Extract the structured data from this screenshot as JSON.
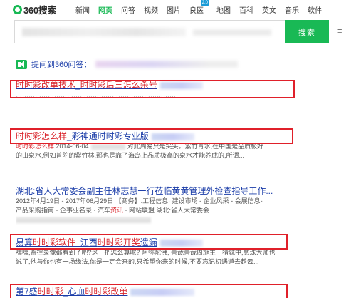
{
  "logo": {
    "text": "360搜索"
  },
  "nav": [
    {
      "label": "新闻",
      "active": false
    },
    {
      "label": "网页",
      "active": true
    },
    {
      "label": "问答",
      "active": false
    },
    {
      "label": "视频",
      "active": false
    },
    {
      "label": "图片",
      "active": false
    },
    {
      "label": "良医",
      "active": false,
      "badge": "2.0"
    },
    {
      "label": "地图",
      "active": false
    },
    {
      "label": "百科",
      "active": false
    },
    {
      "label": "英文",
      "active": false
    },
    {
      "label": "音乐",
      "active": false
    },
    {
      "label": "软件",
      "active": false
    }
  ],
  "search": {
    "button_label": "搜索"
  },
  "notice": {
    "link_text": "提问到360问答："
  },
  "results": [
    {
      "title_red": "时时彩改单技术",
      "title_sep": "_",
      "title_red2": "时时彩后三怎么杀号",
      "line1": "…………………………………………………………………",
      "line2": "…………………………………………………………………"
    },
    {
      "title_red": "时时彩怎么样",
      "title_sep": "_",
      "title_rest": "彩神通时时彩专业版",
      "body_red": "时时彩怎么样",
      "body_date": " 2014-06-04",
      "body_text": "对此周易只是笑笑。紫竹青水,在中国是品质极好",
      "line2": "的山泉水,例如普陀的紫竹林,那也是靠了海岛上品质极高的泉水才能养成的,所谓..."
    },
    {
      "title": "湖北:省人大常委会副主任林志慧一行莅临黄黄管理外检查指导工作...",
      "line1": "2012年4月19日 - 2017年06月29日 【商务】:工程信息· 建设市场 - 企业风采 - 会展信息-",
      "line2_pre": "产品采购指南 · 企事业名录 · 汽车",
      "line2_red": "资讯",
      "line2_post": " · 网站联盟 湖北:省人大常委会...",
      "line3": ""
    },
    {
      "title_pre": "易算",
      "title_red": "时时彩软件",
      "title_mid": "_江西",
      "title_red2": "时时彩开奖",
      "title_post": "遗漏",
      "line1": "嘿嘿,监控录像都看到了吧?这一把怎么算呢? 阿弥陀佛, 善哉善哉周施主一猜就中,慧珠大师也",
      "line2": "说了,他与你也有一场缘法,你是一定会来的,只希望你来的时候,不要忘记初遇道去趁云..."
    },
    {
      "title_pre": "第7感",
      "title_red": "时时彩",
      "title_mid": "_心血",
      "title_red2": "时时彩改单"
    }
  ]
}
